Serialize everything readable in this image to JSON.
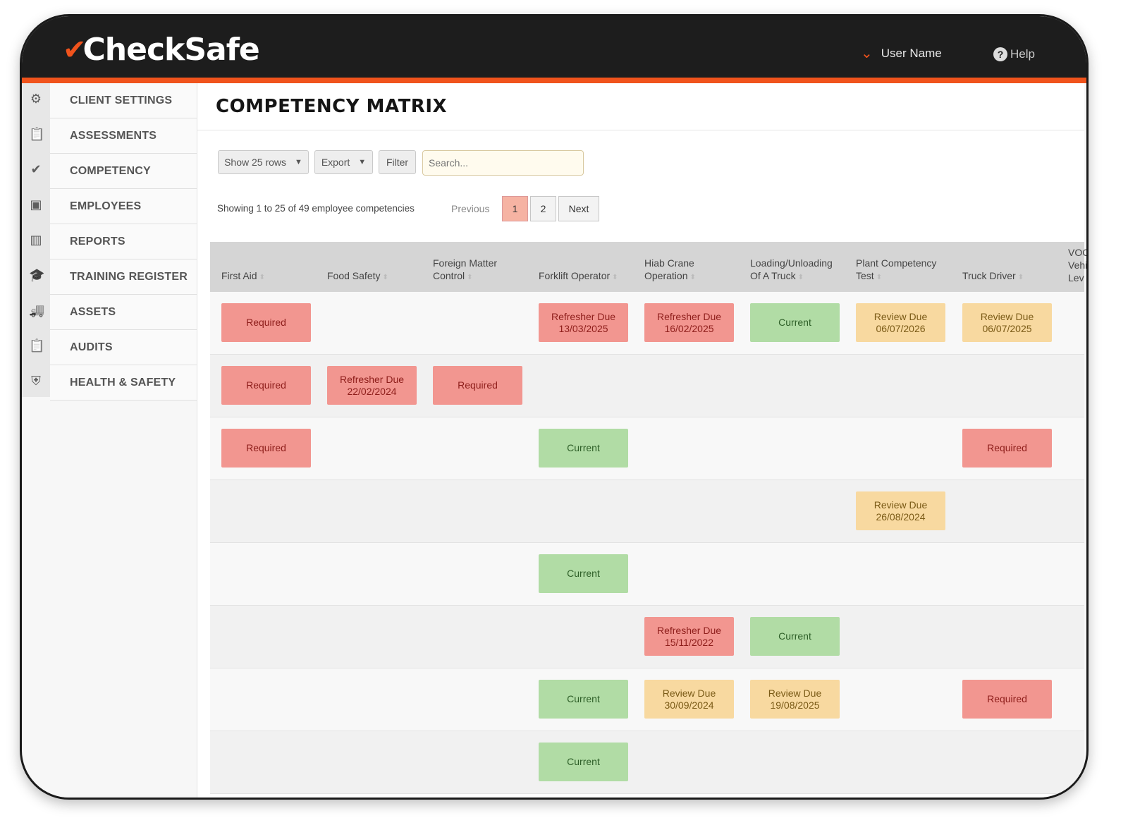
{
  "app": {
    "logo": "CheckSafe",
    "user_name": "User Name",
    "help": "Help"
  },
  "sidebar": {
    "items": [
      {
        "label": "CLIENT SETTINGS",
        "icon": "gear-icon"
      },
      {
        "label": "ASSESSMENTS",
        "icon": "clipboard-icon"
      },
      {
        "label": "COMPETENCY",
        "icon": "check-circle-icon"
      },
      {
        "label": "EMPLOYEES",
        "icon": "contact-card-icon"
      },
      {
        "label": "REPORTS",
        "icon": "bar-chart-icon"
      },
      {
        "label": "TRAINING REGISTER",
        "icon": "graduation-cap-icon"
      },
      {
        "label": "ASSETS",
        "icon": "truck-icon"
      },
      {
        "label": "AUDITS",
        "icon": "clipboard-icon"
      },
      {
        "label": "HEALTH & SAFETY",
        "icon": "shield-icon"
      }
    ]
  },
  "page": {
    "title": "COMPETENCY MATRIX"
  },
  "controls": {
    "show_rows": "Show 25 rows",
    "export": "Export",
    "filter": "Filter",
    "search_placeholder": "Search..."
  },
  "pagination": {
    "info": "Showing 1 to 25 of 49 employee competencies",
    "previous": "Previous",
    "pages": [
      "1",
      "2"
    ],
    "current": "1",
    "next": "Next"
  },
  "table": {
    "columns": [
      "First Aid",
      "Food Safety",
      "Foreign Matter\nControl",
      "Forklift Operator",
      "Hiab Crane\nOperation",
      "Loading/Unloading\nOf A Truck",
      "Plant Competency\nTest",
      "Truck Driver",
      "VOC\nVehi\nLev"
    ],
    "rows": [
      [
        "Required",
        "",
        "",
        "Refresher Due\n13/03/2025",
        "Refresher Due\n16/02/2025",
        "Current",
        "Review Due\n06/07/2026",
        "Review Due\n06/07/2025"
      ],
      [
        "Required",
        "Refresher Due\n22/02/2024",
        "Required",
        "",
        "",
        "",
        "",
        ""
      ],
      [
        "Required",
        "",
        "",
        "Current",
        "",
        "",
        "",
        "Required"
      ],
      [
        "",
        "",
        "",
        "",
        "",
        "",
        "Review Due\n26/08/2024",
        ""
      ],
      [
        "",
        "",
        "",
        "Current",
        "",
        "",
        "",
        ""
      ],
      [
        "",
        "",
        "",
        "",
        "Refresher Due\n15/11/2022",
        "Current",
        "",
        ""
      ],
      [
        "",
        "",
        "",
        "Current",
        "Review Due\n30/09/2024",
        "Review Due\n19/08/2025",
        "",
        "Required"
      ],
      [
        "",
        "",
        "",
        "Current",
        "",
        "",
        "",
        ""
      ]
    ]
  },
  "status_colors": {
    "required": "#f29690",
    "refresher_due": "#f29690",
    "current": "#b1dca5",
    "review_due": "#f8d9a0",
    "accent": "#f0531c"
  }
}
